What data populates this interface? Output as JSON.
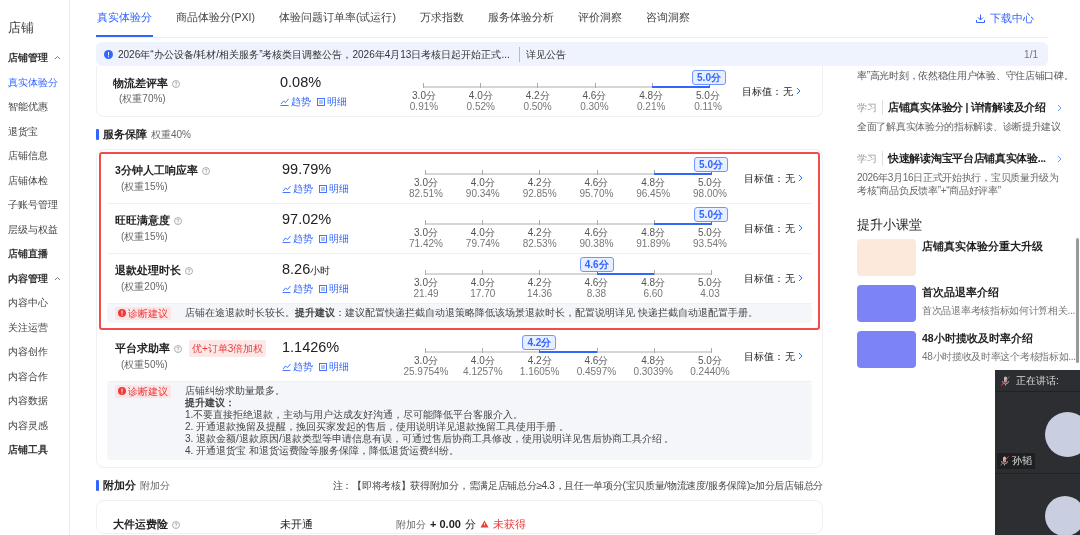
{
  "sidebar": {
    "title": "店铺",
    "groups": [
      {
        "label": "店铺管理",
        "expanded": true,
        "children": [
          {
            "label": "真实体验分",
            "selected": true
          },
          {
            "label": "智能优惠",
            "selected": false
          },
          {
            "label": "退货宝",
            "selected": false
          },
          {
            "label": "店铺信息",
            "selected": false
          },
          {
            "label": "店铺体检",
            "selected": false
          },
          {
            "label": "子账号管理",
            "selected": false
          },
          {
            "label": "层级与权益",
            "selected": false
          }
        ]
      },
      {
        "label": "店铺直播"
      },
      {
        "label": "内容管理",
        "expanded": true,
        "children": [
          {
            "label": "内容中心",
            "selected": false
          },
          {
            "label": "关注运营",
            "selected": false
          },
          {
            "label": "内容创作",
            "selected": false
          },
          {
            "label": "内容合作",
            "selected": false
          },
          {
            "label": "内容数据",
            "selected": false
          },
          {
            "label": "内容灵感",
            "selected": false
          }
        ]
      },
      {
        "label": "店铺工具"
      }
    ]
  },
  "tabs": [
    {
      "label": "真实体验分",
      "selected": true
    },
    {
      "label": "商品体验分(PXI)",
      "selected": false
    },
    {
      "label": "体验问题订单率(试运行)",
      "selected": false
    },
    {
      "label": "万求指数",
      "selected": false
    },
    {
      "label": "服务体验分析",
      "selected": false
    },
    {
      "label": "评价洞察",
      "selected": false
    },
    {
      "label": "咨询洞察",
      "selected": false
    }
  ],
  "download": "下载中心",
  "notice": {
    "text": "2026年“办公设备/耗材/相关服务”考核类目调整公告，2026年4月13日考核日起开始正式...",
    "link": "详见公告",
    "pager": "1/1"
  },
  "top_card": {
    "metrics": [
      {
        "name": "物流差评率",
        "weight": "(权重70%)",
        "value": "0.08%",
        "trend": "趋势",
        "detail": "明细",
        "score": "5.0分",
        "target_label": "目标值：",
        "target": "无",
        "ticks": [
          {
            "label": "3.0分",
            "value": "0.91%",
            "selected": false
          },
          {
            "label": "4.0分",
            "value": "0.52%",
            "selected": false
          },
          {
            "label": "4.2分",
            "value": "0.50%",
            "selected": false
          },
          {
            "label": "4.6分",
            "value": "0.30%",
            "selected": false
          },
          {
            "label": "4.8分",
            "value": "0.21%",
            "selected": false
          },
          {
            "label": "5.0分",
            "value": "0.11%",
            "selected": true
          }
        ]
      }
    ]
  },
  "sections": [
    {
      "title": "服务保障",
      "subtitle": "权重40%",
      "groups": [
        {
          "highlighted": true,
          "metrics": [
            {
              "name": "3分钟人工响应率",
              "weight": "(权重15%)",
              "value": "99.79%",
              "trend": "趋势",
              "detail": "明细",
              "score": "5.0分",
              "target_label": "目标值：",
              "target": "无",
              "ticks": [
                {
                  "label": "3.0分",
                  "value": "82.51%",
                  "selected": false
                },
                {
                  "label": "4.0分",
                  "value": "90.34%",
                  "selected": false
                },
                {
                  "label": "4.2分",
                  "value": "92.85%",
                  "selected": false
                },
                {
                  "label": "4.6分",
                  "value": "95.70%",
                  "selected": false
                },
                {
                  "label": "4.8分",
                  "value": "96.45%",
                  "selected": false
                },
                {
                  "label": "5.0分",
                  "value": "98.00%",
                  "selected": true
                }
              ]
            },
            {
              "name": "旺旺满意度",
              "weight": "(权重15%)",
              "value": "97.02%",
              "trend": "趋势",
              "detail": "明细",
              "score": "5.0分",
              "target_label": "目标值：",
              "target": "无",
              "ticks": [
                {
                  "label": "3.0分",
                  "value": "71.42%",
                  "selected": false
                },
                {
                  "label": "4.0分",
                  "value": "79.74%",
                  "selected": false
                },
                {
                  "label": "4.2分",
                  "value": "82.53%",
                  "selected": false
                },
                {
                  "label": "4.6分",
                  "value": "90.38%",
                  "selected": false
                },
                {
                  "label": "4.8分",
                  "value": "91.89%",
                  "selected": false
                },
                {
                  "label": "5.0分",
                  "value": "93.54%",
                  "selected": true
                }
              ]
            },
            {
              "name": "退款处理时长",
              "weight": "(权重20%)",
              "value": "8.26",
              "unit": "小时",
              "trend": "趋势",
              "detail": "明细",
              "score": "4.6分",
              "target_label": "目标值：",
              "target": "无",
              "ticks": [
                {
                  "label": "3.0分",
                  "value": "21.49",
                  "selected": false
                },
                {
                  "label": "4.0分",
                  "value": "17.70",
                  "selected": false
                },
                {
                  "label": "4.2分",
                  "value": "14.36",
                  "selected": false
                },
                {
                  "label": "4.6分",
                  "value": "8.38",
                  "selected": true
                },
                {
                  "label": "4.8分",
                  "value": "6.60",
                  "selected": false
                },
                {
                  "label": "5.0分",
                  "value": "4.03",
                  "selected": false
                }
              ]
            }
          ],
          "diagnosis": {
            "badge": "诊断建议",
            "lines": [
              [
                {
                  "kind": "text",
                  "text": "店铺在途退款时长较长。"
                },
                {
                  "kind": "bold",
                  "text": "提升建议"
                },
                {
                  "kind": "text",
                  "text": "：建议配置"
                },
                {
                  "kind": "link",
                  "text": "快递拦截自动退策略"
                },
                {
                  "kind": "text",
                  "text": "降低该场景退款时长，配置说明详见 "
                },
                {
                  "kind": "link",
                  "text": "快递拦截自动退配置手册"
                },
                {
                  "kind": "text",
                  "text": "。"
                }
              ]
            ]
          }
        },
        {
          "highlighted": false,
          "metrics": [
            {
              "name": "平台求助率",
              "tag": "优+订单3倍加权",
              "weight": "(权重50%)",
              "value": "1.1426%",
              "trend": "趋势",
              "detail": "明细",
              "score": "4.2分",
              "target_label": "目标值：",
              "target": "无",
              "ticks": [
                {
                  "label": "3.0分",
                  "value": "25.9754%",
                  "selected": false
                },
                {
                  "label": "4.0分",
                  "value": "4.1257%",
                  "selected": false
                },
                {
                  "label": "4.2分",
                  "value": "1.1605%",
                  "selected": true
                },
                {
                  "label": "4.6分",
                  "value": "0.4597%",
                  "selected": false
                },
                {
                  "label": "4.8分",
                  "value": "0.3039%",
                  "selected": false
                },
                {
                  "label": "5.0分",
                  "value": "0.2440%",
                  "selected": false
                }
              ]
            }
          ],
          "diagnosis": {
            "badge": "诊断建议",
            "lines": [
              [
                {
                  "kind": "text",
                  "text": "店铺纠纷求助量最多。"
                }
              ],
              [
                {
                  "kind": "bold",
                  "text": "提升建议："
                }
              ],
              [
                {
                  "kind": "text",
                  "text": "1.不要直接拒绝退款，主动与用户达成友好沟通，尽可能降低平台客服介入。"
                }
              ],
              [
                {
                  "kind": "text",
                  "text": "2. 开通"
                },
                {
                  "kind": "link",
                  "text": "退款挽留及提醒"
                },
                {
                  "kind": "text",
                  "text": "，挽回买家发起的售后，使用说明详见"
                },
                {
                  "kind": "link",
                  "text": "退款挽留工具使用手册"
                },
                {
                  "kind": "text",
                  "text": " 。"
                }
              ],
              [
                {
                  "kind": "text",
                  "text": "3. 退款金额/退款原因/退款类型等申请信息有误，可通过售后协商工具修改，使用说明详见"
                },
                {
                  "kind": "link",
                  "text": "售后协商工具介绍"
                },
                {
                  "kind": "text",
                  "text": " 。"
                }
              ],
              [
                {
                  "kind": "text",
                  "text": "4. 开通"
                },
                {
                  "kind": "link",
                  "text": "退货宝"
                },
                {
                  "kind": "text",
                  "text": " 和"
                },
                {
                  "kind": "link",
                  "text": "退货运费险"
                },
                {
                  "kind": "text",
                  "text": "等服务保障，降低退货运费纠纷。"
                }
              ]
            ]
          }
        }
      ]
    },
    {
      "title": "附加分",
      "subtitle": "附加分",
      "note": "注：【即将考核】获得附加分，需满足店铺总分≥4.3，且任一单项分(宝贝质量/物流速度/服务保障)≥加分后店铺总分",
      "bonus_items": [
        {
          "name": "大件运费险",
          "status": "未开通",
          "bonus_label": "附加分",
          "bonus_value": "+ 0.00",
          "bonus_unit": "分",
          "result": "未获得"
        }
      ]
    }
  ],
  "right_panel": {
    "cut_text": "率”高光时刻，依然稳住用户体验、守住店铺口碑。",
    "articles": [
      {
        "tag": "学习",
        "title": "店铺真实体验分 | 详情解读及介绍",
        "desc": "全面了解真实体验分的指标解读、诊断提升建议"
      },
      {
        "tag": "学习",
        "title": "快速解读淘宝平台店铺真实体验...",
        "desc": "2026年3月16日正式开始执行，宝贝质量升级为考核“商品负反馈率”+“商品好评率”"
      }
    ],
    "course_title": "提升小课堂",
    "courses": [
      {
        "title": "店铺真实体验分重大升级",
        "color": "#fde9dc"
      },
      {
        "title": "首次品退率介绍",
        "desc": "首次品退率考核指标如何计算相关...",
        "color": "#7c83f5"
      },
      {
        "title": "48小时揽收及时率介绍",
        "desc": "48小时揽收及时率这个考核指标如...",
        "color": "#7c83f5"
      }
    ]
  },
  "meeting": {
    "speaking_label": "正在讲话:",
    "participant": "孙韬"
  }
}
